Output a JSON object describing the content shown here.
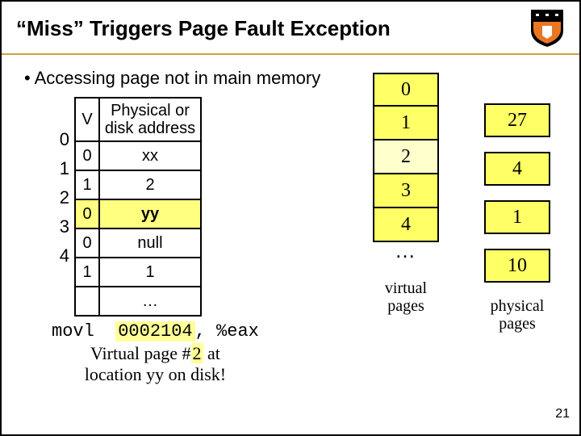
{
  "title": "“Miss” Triggers Page Fault Exception",
  "bullet": "Accessing page not in main memory",
  "ptable": {
    "headers": {
      "v": "V",
      "addr": "Physical or disk address"
    },
    "rows": [
      {
        "idx": "0",
        "v": "0",
        "addr": "xx"
      },
      {
        "idx": "1",
        "v": "1",
        "addr": "2"
      },
      {
        "idx": "2",
        "v": "0",
        "addr": "yy"
      },
      {
        "idx": "3",
        "v": "0",
        "addr": "null"
      },
      {
        "idx": "4",
        "v": "1",
        "addr": "1"
      }
    ],
    "tail": "…"
  },
  "vpages": {
    "items": [
      "0",
      "1",
      "2",
      "3",
      "4"
    ],
    "dots": "…",
    "label": "virtual pages"
  },
  "ppages": {
    "items": [
      "27",
      "4",
      "1",
      "10"
    ],
    "label": "physical pages"
  },
  "code": {
    "instr": "movl",
    "arg": "0002104",
    "rest": ", %eax",
    "desc1a": "Virtual page #",
    "desc1b": "2",
    "desc1c": " at",
    "desc2": "location yy on disk!"
  },
  "slidenum": "21"
}
